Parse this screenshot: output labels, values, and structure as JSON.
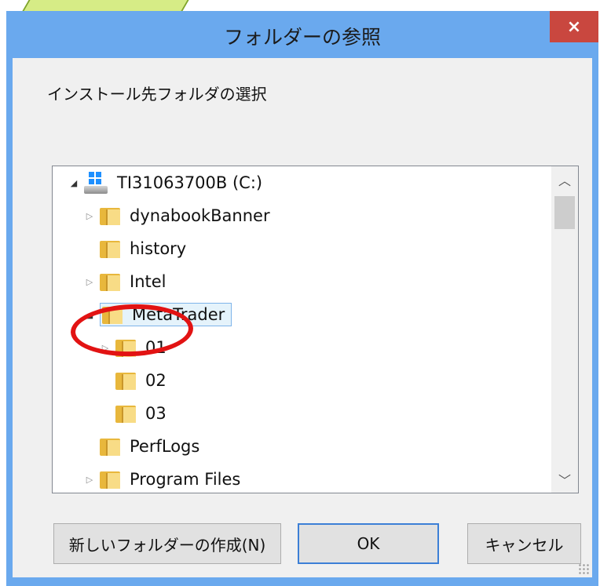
{
  "window": {
    "title": "フォルダーの参照",
    "close_glyph": "×"
  },
  "instruction": "インストール先フォルダの選択",
  "tree": {
    "items": [
      {
        "label": "TI31063700B (C:)",
        "icon": "drive-icon",
        "expander": "◢",
        "expanded": true
      },
      {
        "label": "dynabookBanner",
        "icon": "folder-icon",
        "expander": "▷"
      },
      {
        "label": "history",
        "icon": "folder-icon",
        "expander": ""
      },
      {
        "label": "Intel",
        "icon": "folder-icon",
        "expander": "▷"
      },
      {
        "label": "MetaTrader",
        "icon": "folder-icon",
        "expander": "◢",
        "expanded": true,
        "selected": true
      },
      {
        "label": "01",
        "icon": "folder-icon",
        "expander": "▷"
      },
      {
        "label": "02",
        "icon": "folder-icon",
        "expander": "",
        "highlighted": true
      },
      {
        "label": "03",
        "icon": "folder-icon",
        "expander": ""
      },
      {
        "label": "PerfLogs",
        "icon": "folder-icon",
        "expander": ""
      },
      {
        "label": "Program Files",
        "icon": "folder-icon",
        "expander": "▷"
      }
    ]
  },
  "scrollbar": {
    "up_glyph": "︿",
    "down_glyph": "﹀"
  },
  "buttons": {
    "new_folder": "新しいフォルダーの作成(N)",
    "ok": "OK",
    "cancel": "キャンセル"
  },
  "colors": {
    "title_bar": "#6aa9ee",
    "close_button": "#c9473f",
    "selection_fill": "#e5f3fb",
    "annotation_circle": "#e21313"
  }
}
